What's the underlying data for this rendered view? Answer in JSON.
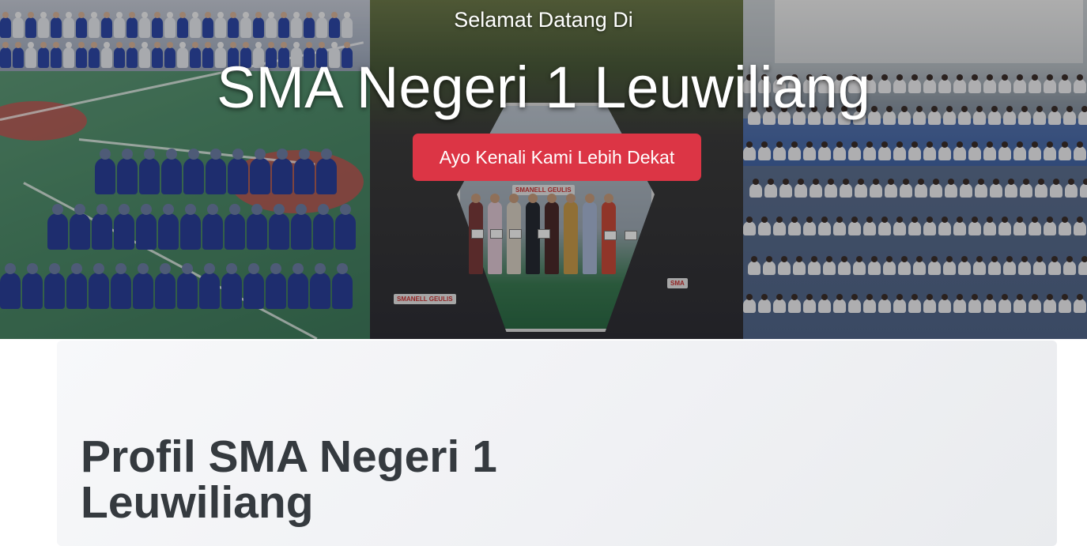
{
  "hero": {
    "eyebrow": "Selamat Datang Di",
    "title": "SMA Negeri 1 Leuwiliang",
    "cta_label": "Ayo Kenali Kami Lebih Dekat",
    "images": [
      {
        "description": "upacara-lapangan"
      },
      {
        "description": "penyerahan-penghargaan"
      },
      {
        "description": "siswa-duduk-lapangan"
      }
    ],
    "banner_texts": [
      "SMANELL GEULIS",
      "SMANELL GEULIS",
      "SMA"
    ]
  },
  "profile": {
    "title": "Profil SMA Negeri 1 Leuwiliang"
  },
  "colors": {
    "cta_background": "#dc3545",
    "title_text": "#353a3f",
    "card_background": "#f3f4f6"
  }
}
